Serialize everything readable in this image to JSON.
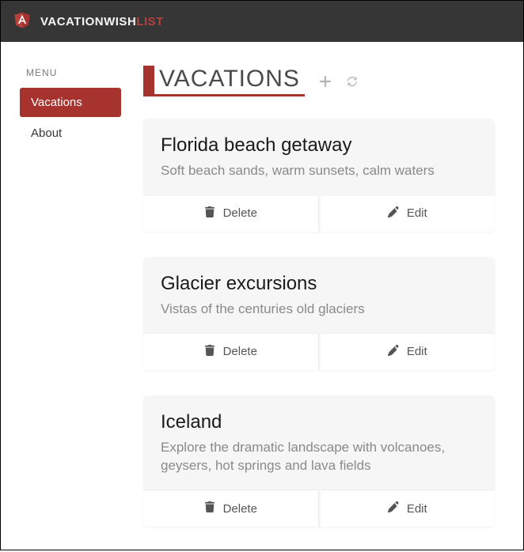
{
  "brand": {
    "part1": "VACATION",
    "part2": "WISH",
    "part3": "LIST"
  },
  "sidebar": {
    "heading": "MENU",
    "items": [
      {
        "label": "Vacations",
        "active": true
      },
      {
        "label": "About",
        "active": false
      }
    ]
  },
  "page": {
    "title": "VACATIONS"
  },
  "actions": {
    "delete": "Delete",
    "edit": "Edit"
  },
  "vacations": [
    {
      "title": "Florida beach getaway",
      "description": "Soft beach sands, warm sunsets, calm waters"
    },
    {
      "title": "Glacier excursions",
      "description": "Vistas of the centuries old glaciers"
    },
    {
      "title": "Iceland",
      "description": "Explore the dramatic landscape with volcanoes, geysers, hot springs and lava fields"
    }
  ]
}
